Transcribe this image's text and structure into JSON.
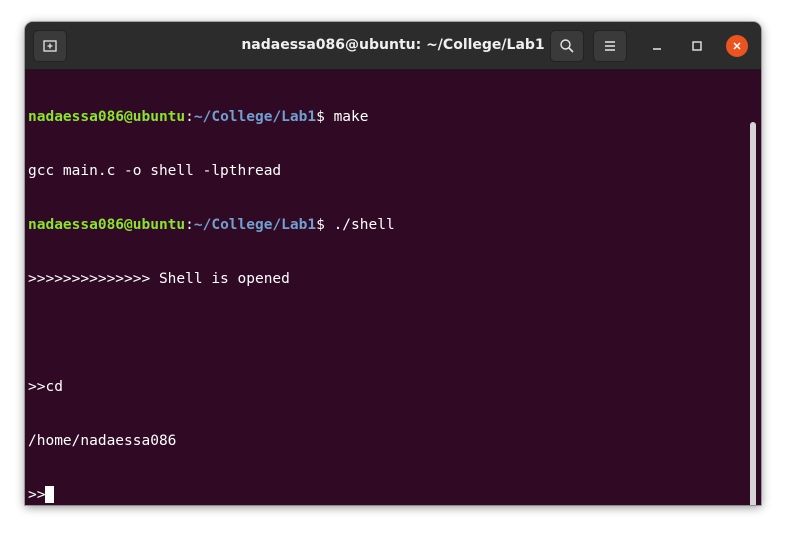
{
  "window": {
    "title": "nadaessa086@ubuntu: ~/College/Lab1"
  },
  "titlebar": {
    "new_tab_icon": "new-tab-icon",
    "search_icon": "search-icon",
    "menu_icon": "hamburger-menu-icon",
    "minimize_icon": "minimize-icon",
    "maximize_icon": "maximize-icon",
    "close_icon": "close-icon"
  },
  "colors": {
    "terminal_bg": "#300a24",
    "user_green": "#8ae234",
    "path_blue": "#729fcf",
    "close_orange": "#e95420"
  },
  "terminal": {
    "prompt1": {
      "user": "nadaessa086@ubuntu",
      "sep": ":",
      "path": "~/College/Lab1",
      "dollar": "$ ",
      "cmd": "make"
    },
    "out1": "gcc main.c -o shell -lpthread",
    "prompt2": {
      "user": "nadaessa086@ubuntu",
      "sep": ":",
      "path": "~/College/Lab1",
      "dollar": "$ ",
      "cmd": "./shell"
    },
    "out2": ">>>>>>>>>>>>>> Shell is opened",
    "blank": "",
    "cmd3": ">>cd",
    "out3": "/home/nadaessa086",
    "prompt4": ">>"
  }
}
